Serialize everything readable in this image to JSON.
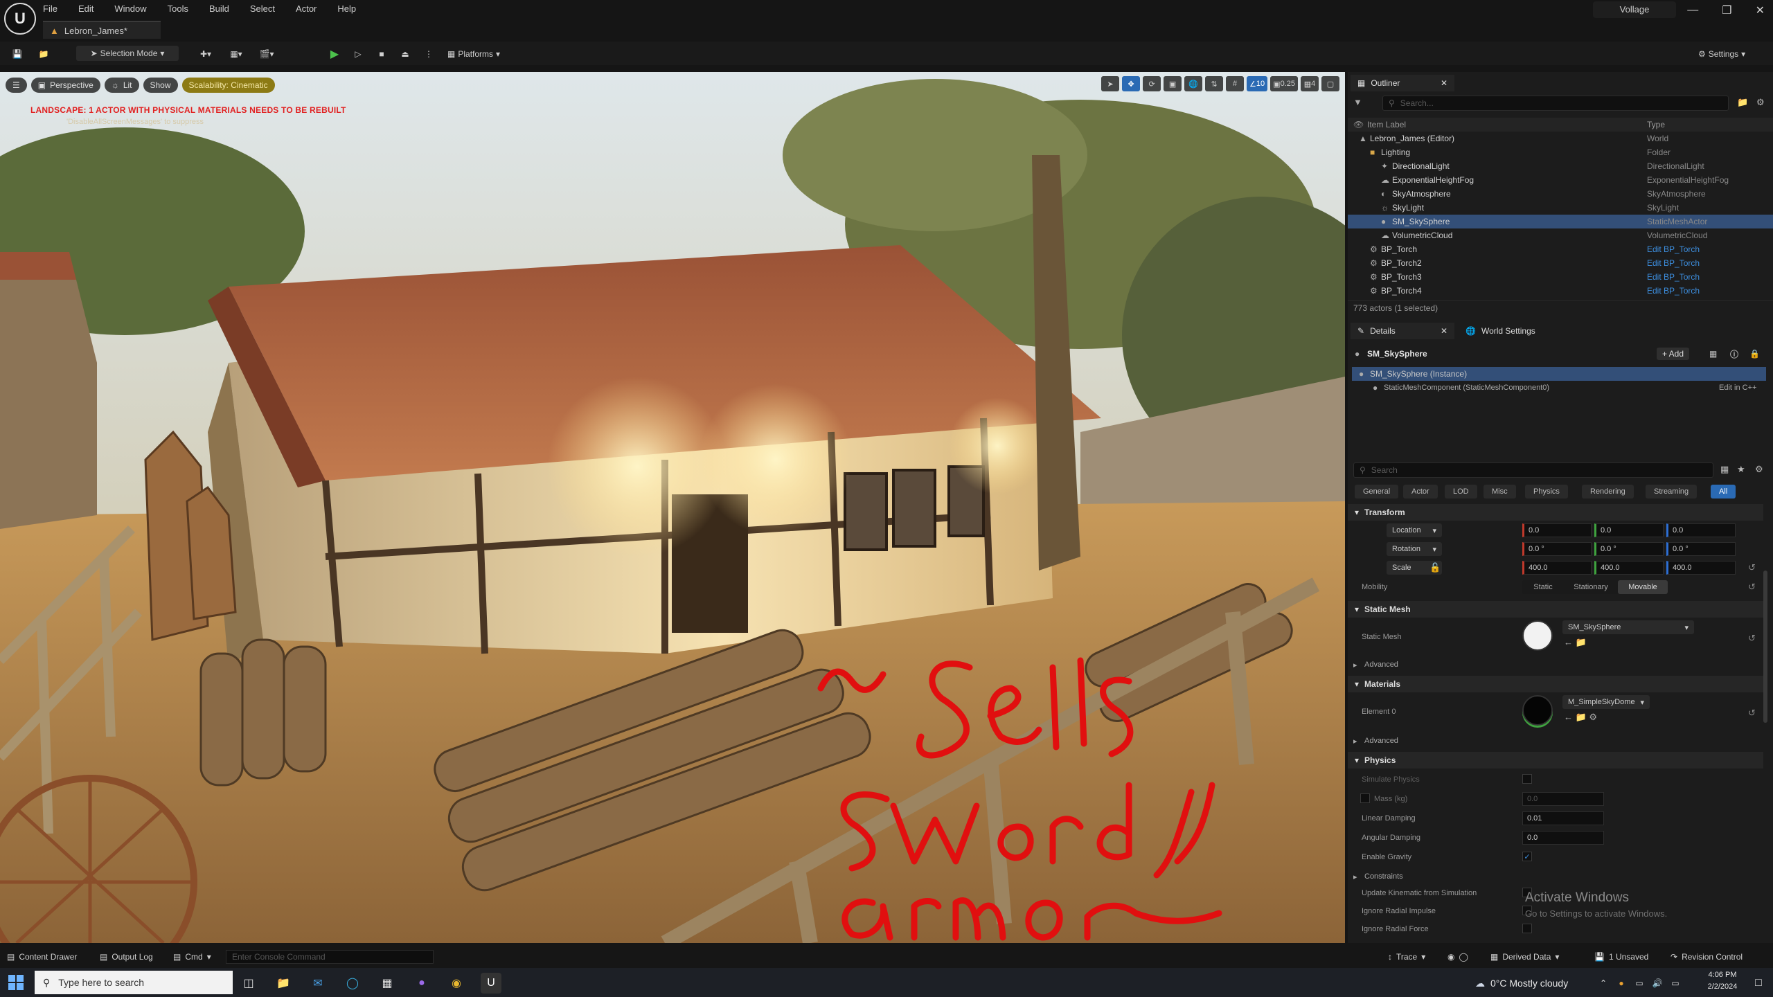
{
  "menu": {
    "items": [
      "File",
      "Edit",
      "Window",
      "Tools",
      "Build",
      "Select",
      "Actor",
      "Help"
    ],
    "project_name": "Vollage"
  },
  "tab": {
    "level_name": "Lebron_James*"
  },
  "toolbar": {
    "selection_mode": "Selection Mode",
    "platforms": "Platforms",
    "settings": "Settings"
  },
  "viewport": {
    "perspective": "Perspective",
    "lit": "Lit",
    "show": "Show",
    "scalability": "Scalability: Cinematic",
    "warning": "LANDSCAPE: 1 ACTOR WITH PHYSICAL MATERIALS NEEDS TO BE REBUILT",
    "suppress": "'DisableAllScreenMessages' to suppress",
    "snap_rotation": "10",
    "camera_speed": "0.25",
    "grid_snap": "4",
    "annotation_color": "#e10f0f"
  },
  "outliner": {
    "tab_label": "Outliner",
    "search_placeholder": "Search...",
    "col_label": "Item Label",
    "col_type": "Type",
    "items": [
      {
        "label": "Lebron_James (Editor)",
        "type": "World"
      },
      {
        "label": "Lighting",
        "type": "Folder"
      },
      {
        "label": "DirectionalLight",
        "type": "DirectionalLight"
      },
      {
        "label": "ExponentialHeightFog",
        "type": "ExponentialHeightFog"
      },
      {
        "label": "SkyAtmosphere",
        "type": "SkyAtmosphere"
      },
      {
        "label": "SkyLight",
        "type": "SkyLight"
      },
      {
        "label": "SM_SkySphere",
        "type": "StaticMeshActor"
      },
      {
        "label": "VolumetricCloud",
        "type": "VolumetricCloud"
      },
      {
        "label": "BP_Torch",
        "type": "Edit BP_Torch"
      },
      {
        "label": "BP_Torch2",
        "type": "Edit BP_Torch"
      },
      {
        "label": "BP_Torch3",
        "type": "Edit BP_Torch"
      },
      {
        "label": "BP_Torch4",
        "type": "Edit BP_Torch"
      }
    ],
    "footer": "773 actors (1 selected)"
  },
  "details": {
    "tab_label": "Details",
    "world_settings": "World Settings",
    "actor_name": "SM_SkySphere",
    "add_label": "+ Add",
    "instance_row": "SM_SkySphere (Instance)",
    "component_row": "StaticMeshComponent (StaticMeshComponent0)",
    "edit_cpp": "Edit in C++",
    "search_placeholder": "Search",
    "filters": [
      "General",
      "Actor",
      "LOD",
      "Misc",
      "Physics",
      "Rendering",
      "Streaming",
      "All"
    ],
    "transform_title": "Transform",
    "location_label": "Location",
    "rotation_label": "Rotation",
    "scale_label": "Scale",
    "location": [
      "0.0",
      "0.0",
      "0.0"
    ],
    "rotation": [
      "0.0 °",
      "0.0 °",
      "0.0 °"
    ],
    "scale": [
      "400.0",
      "400.0",
      "400.0"
    ],
    "mobility_label": "Mobility",
    "mobility": [
      "Static",
      "Stationary",
      "Movable"
    ],
    "static_mesh_title": "Static Mesh",
    "static_mesh_label": "Static Mesh",
    "static_mesh_value": "SM_SkySphere",
    "advanced_label": "Advanced",
    "materials_title": "Materials",
    "element0_label": "Element 0",
    "element0_value": "M_SimpleSkyDome",
    "advanced2_label": "Advanced",
    "physics_title": "Physics",
    "simulate_physics": "Simulate Physics",
    "mass_kg": "Mass (kg)",
    "mass_value": "0.0",
    "linear_damping": "Linear Damping",
    "linear_damping_value": "0.01",
    "angular_damping": "Angular Damping",
    "angular_damping_value": "0.0",
    "enable_gravity": "Enable Gravity",
    "constraints": "Constraints",
    "update_kinematic": "Update Kinematic from Simulation",
    "ignore_radial_impulse": "Ignore Radial Impulse",
    "ignore_radial_force": "Ignore Radial Force"
  },
  "watermark": {
    "title": "Activate Windows",
    "subtitle": "Go to Settings to activate Windows."
  },
  "bottom": {
    "content_drawer": "Content Drawer",
    "output_log": "Output Log",
    "cmd": "Cmd",
    "console_placeholder": "Enter Console Command",
    "trace": "Trace",
    "derived_data": "Derived Data",
    "unsaved": "1 Unsaved",
    "revision_control": "Revision Control"
  },
  "taskbar": {
    "search_placeholder": "Type here to search",
    "weather": "0°C  Mostly cloudy",
    "time": "4:06 PM",
    "date": "2/2/2024"
  }
}
